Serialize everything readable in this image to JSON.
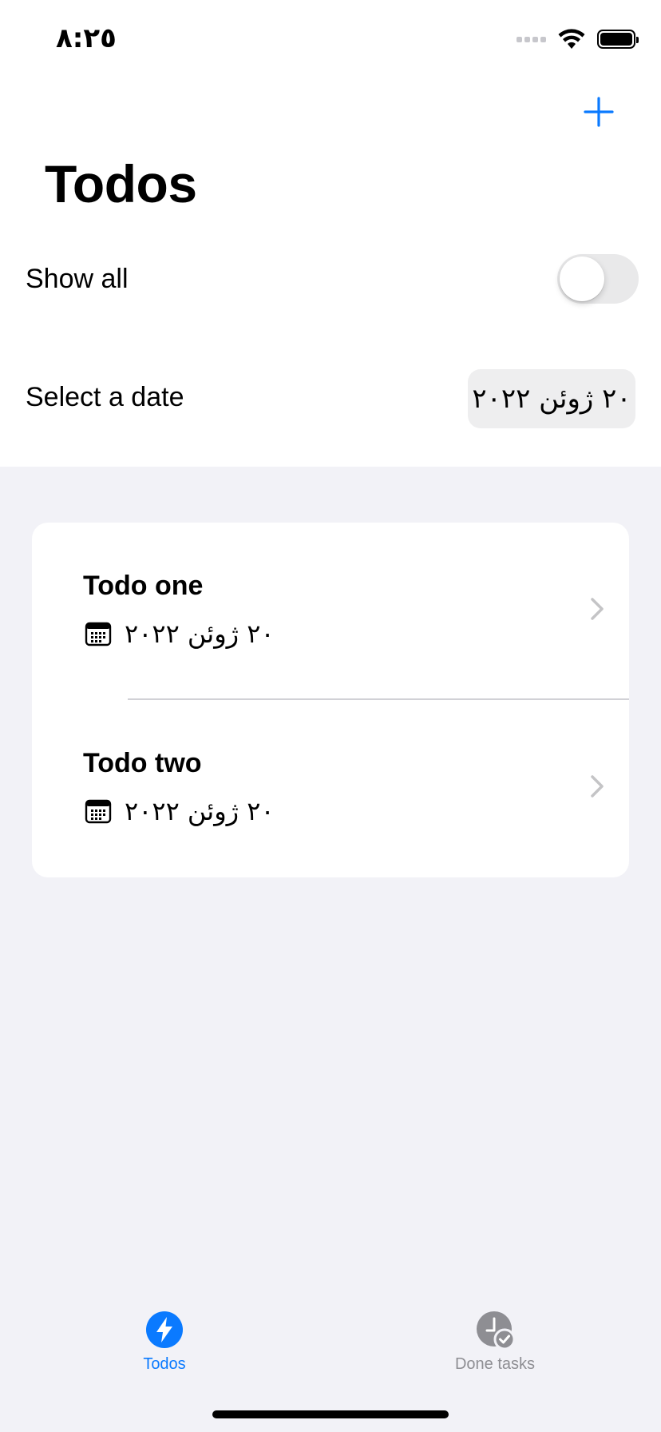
{
  "status_bar": {
    "time": "٨:٢٥"
  },
  "header": {
    "title": "Todos"
  },
  "settings": {
    "show_all_label": "Show all",
    "show_all_enabled": false,
    "select_date_label": "Select a date",
    "selected_date": "٢٠ ژوئن ٢٠٢٢"
  },
  "todos": [
    {
      "title": "Todo one",
      "date": "٢٠ ژوئن ٢٠٢٢"
    },
    {
      "title": "Todo two",
      "date": "٢٠ ژوئن ٢٠٢٢"
    }
  ],
  "tab_bar": {
    "tabs": [
      {
        "label": "Todos",
        "icon": "bolt-icon",
        "selected": true
      },
      {
        "label": "Done tasks",
        "icon": "clock-check-icon",
        "selected": false
      }
    ]
  },
  "colors": {
    "accent": "#0a7aff",
    "inactive": "#8e8e93",
    "background": "#f2f2f7"
  }
}
